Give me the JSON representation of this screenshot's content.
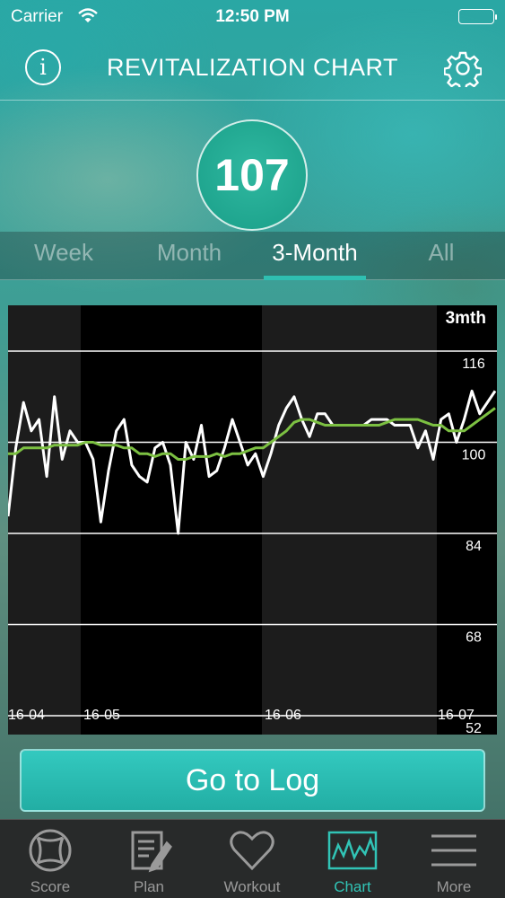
{
  "status_bar": {
    "carrier": "Carrier",
    "time": "12:50 PM"
  },
  "nav": {
    "title": "REVITALIZATION CHART",
    "info_icon": "info-icon",
    "settings_icon": "gear-icon"
  },
  "score": {
    "value": "107"
  },
  "tabs": [
    {
      "label": "Week",
      "active": false
    },
    {
      "label": "Month",
      "active": false
    },
    {
      "label": "3-Month",
      "active": true
    },
    {
      "label": "All",
      "active": false
    }
  ],
  "chart_data": {
    "type": "line",
    "range_label": "3mth",
    "y_ticks": [
      116,
      100,
      84,
      68,
      52
    ],
    "ylim": [
      52,
      116
    ],
    "x_ticks": [
      "16-04",
      "16-05",
      "16-06",
      "16-07"
    ],
    "colors": {
      "raw": "#ffffff",
      "average": "#7cc042",
      "background": "#1c1c1c",
      "band": "#000000"
    },
    "series": [
      {
        "values": [
          87,
          99,
          107,
          102,
          104,
          94,
          108,
          97,
          102,
          100,
          100,
          97,
          86,
          95,
          102,
          104,
          96,
          94,
          93,
          99,
          100,
          96,
          84,
          100,
          97,
          103,
          94,
          95,
          99,
          104,
          100,
          96,
          98,
          94,
          98,
          103,
          106,
          108,
          104,
          101,
          105,
          105,
          103,
          103,
          103,
          103,
          103,
          104,
          104,
          104,
          103,
          103,
          103,
          99,
          102,
          97,
          104,
          105,
          100,
          104,
          109,
          105,
          107,
          109
        ]
      },
      {
        "values": [
          98,
          98,
          99,
          99,
          99,
          99,
          99.5,
          99.5,
          99.5,
          99.5,
          100,
          100,
          99.5,
          99.5,
          99.5,
          99,
          99,
          98,
          98,
          97.5,
          98,
          98,
          97,
          97,
          97.5,
          97.5,
          97.5,
          98,
          97.5,
          98,
          98,
          98.5,
          99,
          99,
          100,
          101,
          102,
          103.5,
          104,
          104,
          103.5,
          103,
          103,
          103,
          103,
          103,
          103,
          103,
          103,
          103.5,
          104,
          104,
          104,
          104,
          103.5,
          103,
          103,
          102,
          102,
          102,
          103,
          104,
          105,
          106
        ]
      }
    ]
  },
  "log_button": {
    "label": "Go to Log"
  },
  "tab_bar": [
    {
      "label": "Score",
      "icon": "score-ring-icon",
      "active": false
    },
    {
      "label": "Plan",
      "icon": "plan-notepad-icon",
      "active": false
    },
    {
      "label": "Workout",
      "icon": "heart-icon",
      "active": false
    },
    {
      "label": "Chart",
      "icon": "chart-icon",
      "active": true
    },
    {
      "label": "More",
      "icon": "menu-lines-icon",
      "active": false
    }
  ]
}
